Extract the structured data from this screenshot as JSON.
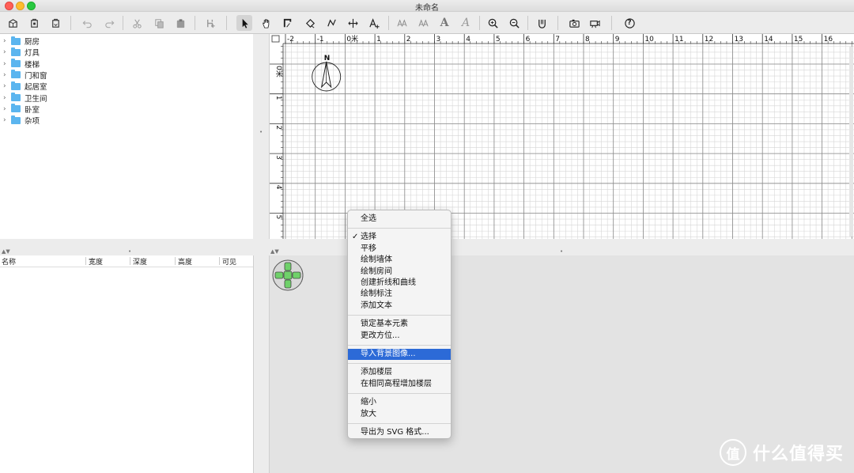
{
  "window": {
    "title": "未命名"
  },
  "toolbar": {
    "buttons": [
      {
        "name": "new-home-icon"
      },
      {
        "name": "open-icon"
      },
      {
        "name": "save-icon"
      },
      {
        "name": "undo-icon"
      },
      {
        "name": "redo-icon"
      },
      {
        "name": "cut-icon"
      },
      {
        "name": "copy-icon"
      },
      {
        "name": "paste-icon"
      },
      {
        "name": "add-furniture-icon"
      },
      {
        "name": "select-arrow-icon"
      },
      {
        "name": "pan-hand-icon"
      },
      {
        "name": "create-walls-icon"
      },
      {
        "name": "create-rooms-icon"
      },
      {
        "name": "create-polylines-icon"
      },
      {
        "name": "create-dimensions-icon"
      },
      {
        "name": "add-text-icon"
      },
      {
        "name": "text-style-icon"
      },
      {
        "name": "text-style-2-icon"
      },
      {
        "name": "bold-icon"
      },
      {
        "name": "italic-icon"
      },
      {
        "name": "zoom-in-icon"
      },
      {
        "name": "zoom-out-icon"
      },
      {
        "name": "3d-view-icon"
      },
      {
        "name": "photo-icon"
      },
      {
        "name": "video-icon"
      },
      {
        "name": "help-icon"
      }
    ],
    "text_a_large": "A",
    "text_a_italic": "A",
    "help_glyph": "?"
  },
  "catalog": {
    "categories": [
      "厨房",
      "灯具",
      "楼梯",
      "门和窗",
      "起居室",
      "卫生间",
      "卧室",
      "杂项"
    ]
  },
  "furniture_table": {
    "columns": [
      "名称",
      "宽度",
      "深度",
      "高度",
      "可见"
    ]
  },
  "plan": {
    "x_ruler_labels": [
      "-2",
      "-1",
      "0米",
      "1",
      "2",
      "3",
      "4",
      "5",
      "6",
      "7",
      "8",
      "9",
      "10",
      "11",
      "12",
      "13",
      "14",
      "15",
      "16"
    ],
    "y_ruler_labels": [
      "0米",
      "1",
      "2",
      "3",
      "4",
      "5"
    ],
    "compass_label": "N"
  },
  "context_menu": {
    "groups": [
      [
        {
          "label": "全选"
        }
      ],
      [
        {
          "label": "选择",
          "checked": true
        },
        {
          "label": "平移"
        },
        {
          "label": "绘制墙体"
        },
        {
          "label": "绘制房间"
        },
        {
          "label": "创建折线和曲线"
        },
        {
          "label": "绘制标注"
        },
        {
          "label": "添加文本"
        }
      ],
      [
        {
          "label": "锁定基本元素"
        },
        {
          "label": "更改方位..."
        }
      ],
      [
        {
          "label": "导入背景图像...",
          "highlighted": true
        }
      ],
      [
        {
          "label": "添加楼层"
        },
        {
          "label": "在相同高程增加楼层"
        }
      ],
      [
        {
          "label": "缩小"
        },
        {
          "label": "放大"
        }
      ],
      [
        {
          "label": "导出为 SVG 格式..."
        }
      ]
    ],
    "check_mark": "✓"
  },
  "watermark": {
    "logo_text": "值",
    "text": "什么值得买"
  },
  "colors": {
    "folder": "#5bb5ef",
    "menu_highlight": "#2c6ad7",
    "nav_green": "#6fd16a"
  }
}
